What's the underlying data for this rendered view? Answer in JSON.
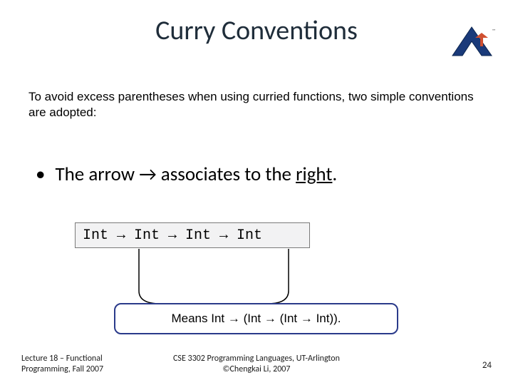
{
  "title": "Curry Conventions",
  "intro": "To avoid excess parentheses when using curried functions, two simple conventions are adopted:",
  "bullet": {
    "pre": "The arrow ",
    "arrow": "→",
    "mid": " associates to the ",
    "emph": "right",
    "post": "."
  },
  "code": "Int → Int → Int → Int",
  "means": "Means Int → (Int → (Int → Int)).",
  "footer": {
    "left_line1": "Lecture 18 – Functional",
    "left_line2": "Programming, Fall 2007",
    "center_line1": "CSE 3302 Programming Languages, UT-Arlington",
    "center_line2": "©Chengkai Li, 2007",
    "page": "24"
  }
}
